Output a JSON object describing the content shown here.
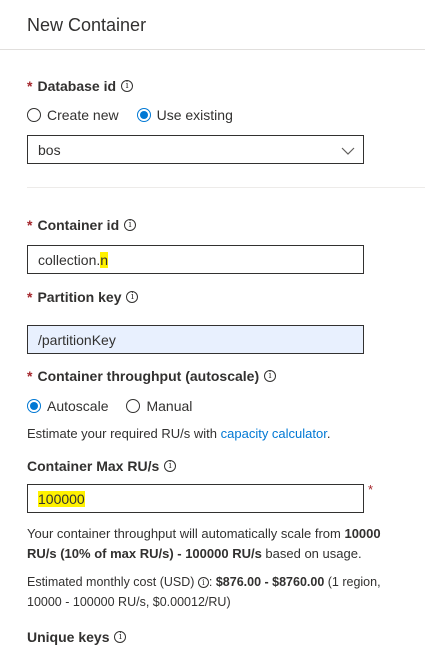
{
  "header": {
    "title": "New Container"
  },
  "database": {
    "label": "Database id",
    "options": [
      "Create new",
      "Use existing"
    ],
    "selected": "Use existing",
    "value": "bos"
  },
  "container": {
    "label": "Container id",
    "value_main": "collection.",
    "value_highlight": "n"
  },
  "partition": {
    "label": "Partition key",
    "value": "/partitionKey"
  },
  "throughput": {
    "label": "Container throughput (autoscale)",
    "options": [
      "Autoscale",
      "Manual"
    ],
    "selected": "Autoscale",
    "estimate_prefix": "Estimate your required RU/s with ",
    "estimate_link": "capacity calculator",
    "estimate_suffix": "."
  },
  "max_ru": {
    "label": "Container Max RU/s",
    "value": "100000",
    "required_mark": "*"
  },
  "scale_info": {
    "line1_prefix": "Your container throughput will automatically scale from ",
    "line1_bold": "10000",
    "line2_bold": "RU/s (10% of max RU/s) - 100000 RU/s",
    "line2_suffix": " based on usage."
  },
  "cost": {
    "prefix": "Estimated monthly cost (USD) ",
    "colon": ": ",
    "amount": "$876.00 - $8760.00",
    "detail_line1": " (1 region,",
    "detail_line2": "10000 - 100000 RU/s, $0.00012/RU)"
  },
  "unique_keys": {
    "label": "Unique keys"
  },
  "colors": {
    "accent": "#0078d4",
    "required": "#a4262c",
    "highlight": "#fff200"
  }
}
